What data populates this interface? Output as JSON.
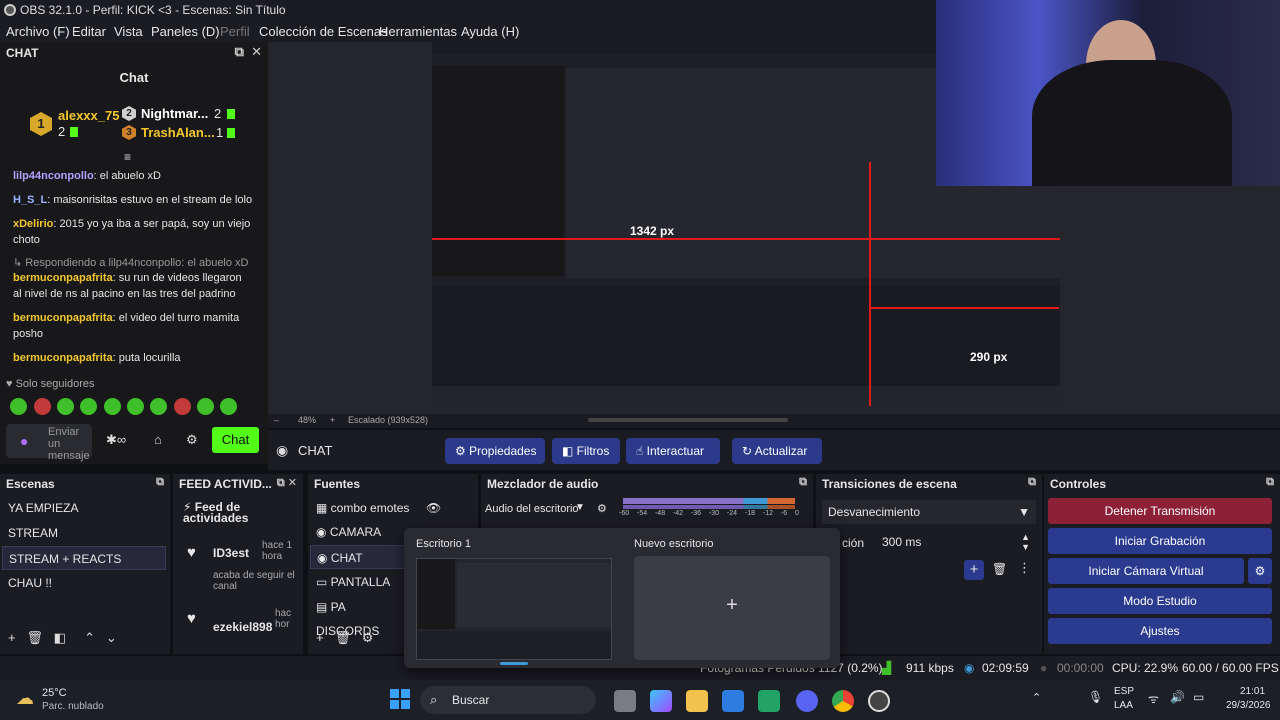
{
  "window": {
    "title": "OBS 32.1.0 - Perfil: KICK <3 - Escenas: Sin Título"
  },
  "menu": [
    "Archivo (F)",
    "Editar",
    "Vista",
    "Paneles (D)",
    "Perfil",
    "Colección de Escenas",
    "Herramientas",
    "Ayuda (H)"
  ],
  "chat": {
    "dock_title": "CHAT",
    "title": "Chat",
    "leaderboard": [
      {
        "rank": "1",
        "name": "alexxx_75",
        "count": "2"
      },
      {
        "rank": "2",
        "name": "Nightmar...",
        "count": "2"
      },
      {
        "rank": "3",
        "name": "TrashAlan...",
        "count": "1"
      }
    ],
    "messages": [
      {
        "user": "lilp44nconpollo",
        "text": ": el abuelo xD"
      },
      {
        "user": "H_S_L",
        "text": ": maisonrisitas estuvo en el stream de lolo"
      },
      {
        "user": "xDelirio",
        "text": ": 2015 yo ya iba a ser papá, soy un viejo choto"
      },
      {
        "user": "",
        "text": "Respondiendo a lilp44nconpollo: el abuelo xD"
      },
      {
        "user": "bermuconpapafrita",
        "text": ": su run de videos llegaron al nivel de ns al pacino en las tres del padrino"
      },
      {
        "user": "bermuconpapafrita",
        "text": ": el video del turro mamita posho"
      },
      {
        "user": "bermuconpapafrita",
        "text": ": puta locurilla"
      }
    ],
    "followers_only": "Solo seguidores",
    "input_placeholder": "Enviar un mensaje",
    "send_label": "Chat",
    "accent": "#53fc18"
  },
  "preview": {
    "zoom": "48%",
    "scaling": "Escalado (939x528)"
  },
  "source_bar": {
    "current": "CHAT",
    "buttons": [
      "Propiedades",
      "Filtros",
      "Interactuar",
      "Actualizar"
    ]
  },
  "canvas_labels": {
    "width_label": "1342 px",
    "height_label": "290 px"
  },
  "scenes": {
    "title": "Escenas",
    "items": [
      "YA EMPIEZA",
      "STREAM",
      "STREAM + REACTS",
      "CHAU !!"
    ],
    "selected": "STREAM + REACTS"
  },
  "feed": {
    "title": "FEED ACTIVID...",
    "header": "Feed de actividades",
    "items": [
      {
        "user": "ID3est",
        "time": "hace 1 hora",
        "text": "acaba de seguir el canal"
      },
      {
        "user": "ezekiel898",
        "time": "hac hor",
        "text": ""
      }
    ]
  },
  "sources": {
    "title": "Fuentes",
    "items": [
      "combo emotes",
      "CAMARA",
      "CHAT",
      "PANTALLA",
      "PA DISCORDS"
    ]
  },
  "mixer": {
    "title": "Mezclador de audio",
    "channel": "Audio del escritorio",
    "ticks": [
      "-60",
      "-54",
      "-48",
      "-42",
      "-36",
      "-30",
      "-24",
      "-18",
      "-12",
      "-6",
      "0"
    ]
  },
  "transitions": {
    "title": "Transiciones de escena",
    "selected": "Desvanecimiento",
    "duration_label": "ción",
    "duration": "300 ms"
  },
  "controls": {
    "title": "Controles",
    "buttons": [
      "Detener Transmisión",
      "Iniciar Grabación",
      "Iniciar Cámara Virtual",
      "Modo Estudio",
      "Ajustes"
    ]
  },
  "desktops": {
    "d1": "Escritorio 1",
    "d2": "Nuevo escritorio"
  },
  "status": {
    "dropped": "Fotogramas Perdidos 1127 (0.2%)",
    "bitrate": "911 kbps",
    "stream_time": "02:09:59",
    "rec_time": "00:00:00",
    "cpu": "CPU: 22.9%",
    "fps": "60.00 / 60.00 FPS"
  },
  "taskbar": {
    "weather_temp": "25°C",
    "weather_desc": "Parc. nublado",
    "search": "Buscar",
    "lang": "ESP",
    "region": "LAA",
    "time": "21:01",
    "date": "29/3/2026"
  }
}
